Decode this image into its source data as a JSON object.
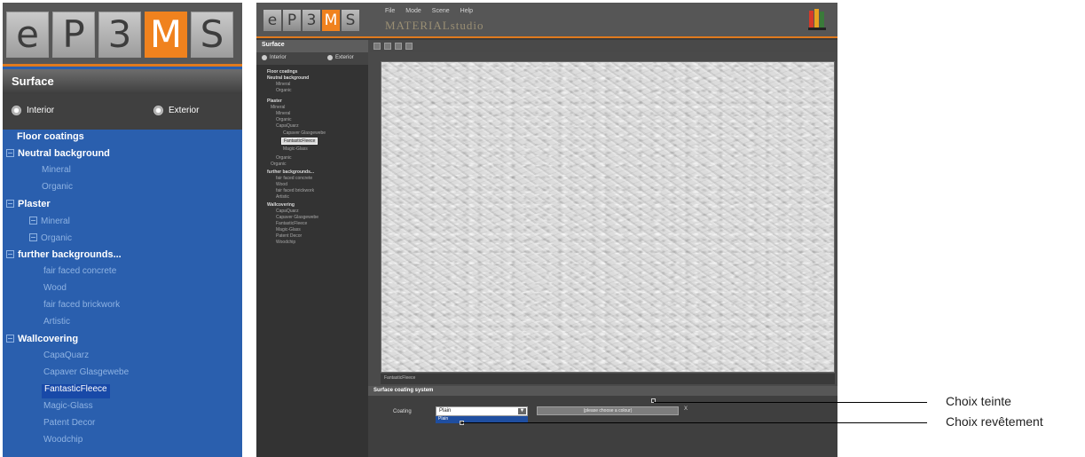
{
  "logo": {
    "letters": [
      "e",
      "P",
      "3",
      "M",
      "S"
    ],
    "accent_color": "#f0821e"
  },
  "zoom_panel": {
    "title": "Surface",
    "radios": {
      "interior": "Interior",
      "exterior": "Exterior"
    },
    "tree": [
      {
        "label": "Floor coatings",
        "type": "heading"
      },
      {
        "label": "Neutral background",
        "type": "heading"
      },
      {
        "label": "Mineral",
        "type": "sub"
      },
      {
        "label": "Organic",
        "type": "sub"
      },
      {
        "label": "Plaster",
        "type": "heading"
      },
      {
        "label": "Mineral",
        "type": "sub"
      },
      {
        "label": "Organic",
        "type": "sub"
      },
      {
        "label": "further backgrounds...",
        "type": "heading"
      },
      {
        "label": "fair faced concrete",
        "type": "sub"
      },
      {
        "label": "Wood",
        "type": "sub"
      },
      {
        "label": "fair faced brickwork",
        "type": "sub"
      },
      {
        "label": "Artistic",
        "type": "sub"
      },
      {
        "label": "Wallcovering",
        "type": "heading"
      },
      {
        "label": "CapaQuarz",
        "type": "sub"
      },
      {
        "label": "Capaver Glasgewebe",
        "type": "sub"
      },
      {
        "label": "FantasticFleece",
        "type": "selected"
      },
      {
        "label": "Magic-Glass",
        "type": "sub"
      },
      {
        "label": "Patent Decor",
        "type": "sub"
      },
      {
        "label": "Woodchip",
        "type": "sub"
      }
    ]
  },
  "app": {
    "menu": [
      "File",
      "Mode",
      "Scene",
      "Help"
    ],
    "brand": "MATERIALstudio",
    "left_panel": {
      "title": "Surface",
      "radios": {
        "interior": "Interior",
        "exterior": "Exterior"
      }
    },
    "bottom_panel": {
      "title": "Surface coating system",
      "coating_label": "Coating",
      "coating_value": "Plain",
      "coating_option": "Plain",
      "tint_button": "(please choose a colour)",
      "close": "X"
    }
  },
  "callouts": {
    "tint": "Choix teinte",
    "coating": "Choix revêtement"
  }
}
